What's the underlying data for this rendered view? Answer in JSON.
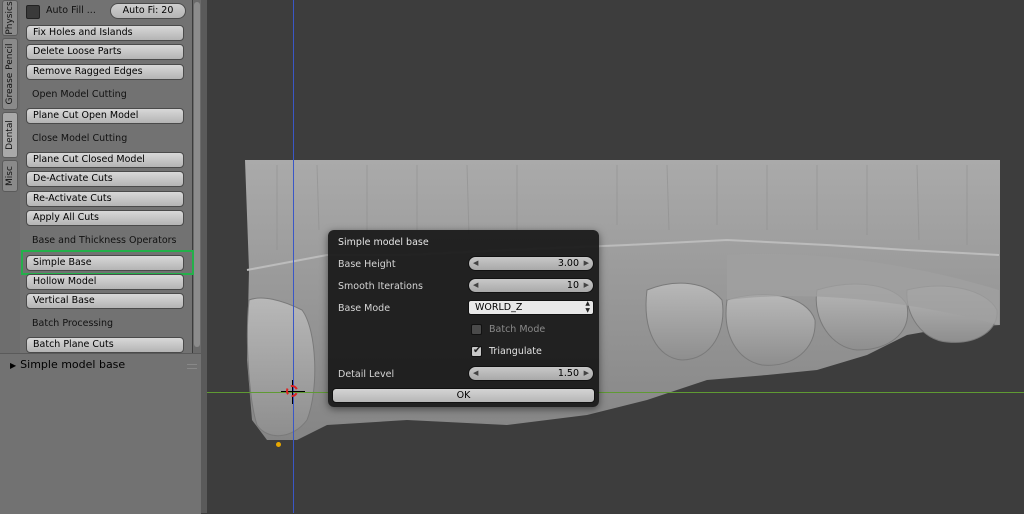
{
  "tabs": [
    {
      "label": "Physics"
    },
    {
      "label": "Grease Pencil"
    },
    {
      "label": "Dental"
    },
    {
      "label": "Misc"
    }
  ],
  "panel": {
    "auto_fill_label": "Auto Fill ...",
    "auto_fill_field": "Auto Fi: 20",
    "buttons": {
      "fix_holes": "Fix Holes and Islands",
      "delete_loose": "Delete Loose Parts",
      "remove_ragged": "Remove Ragged Edges",
      "plane_cut_open": "Plane Cut Open Model",
      "plane_cut_closed": "Plane Cut Closed Model",
      "deactivate_cuts": "De-Activate Cuts",
      "reactivate_cuts": "Re-Activate Cuts",
      "apply_all_cuts": "Apply All Cuts",
      "simple_base": "Simple Base",
      "hollow_model": "Hollow Model",
      "vertical_base": "Vertical Base",
      "batch_plane_cuts": "Batch Plane Cuts"
    },
    "labels": {
      "open_model_cutting": "Open Model Cutting",
      "close_model_cutting": "Close Model Cutting",
      "base_thickness": "Base and Thickness Operators",
      "batch_processing": "Batch Processing"
    },
    "highlight_color": "#23b04a"
  },
  "lower_panel": {
    "title": "Simple model base"
  },
  "dialog": {
    "title": "Simple model base",
    "base_height_label": "Base Height",
    "base_height_value": "3.00",
    "smooth_iterations_label": "Smooth Iterations",
    "smooth_iterations_value": "10",
    "base_mode_label": "Base Mode",
    "base_mode_value": "WORLD_Z",
    "batch_mode_label": "Batch Mode",
    "batch_mode_checked": false,
    "triangulate_label": "Triangulate",
    "triangulate_checked": true,
    "detail_level_label": "Detail Level",
    "detail_level_value": "1.50",
    "ok_label": "OK"
  },
  "icons": {
    "cursor": "3d-cursor-icon",
    "origin": "object-origin-icon"
  }
}
